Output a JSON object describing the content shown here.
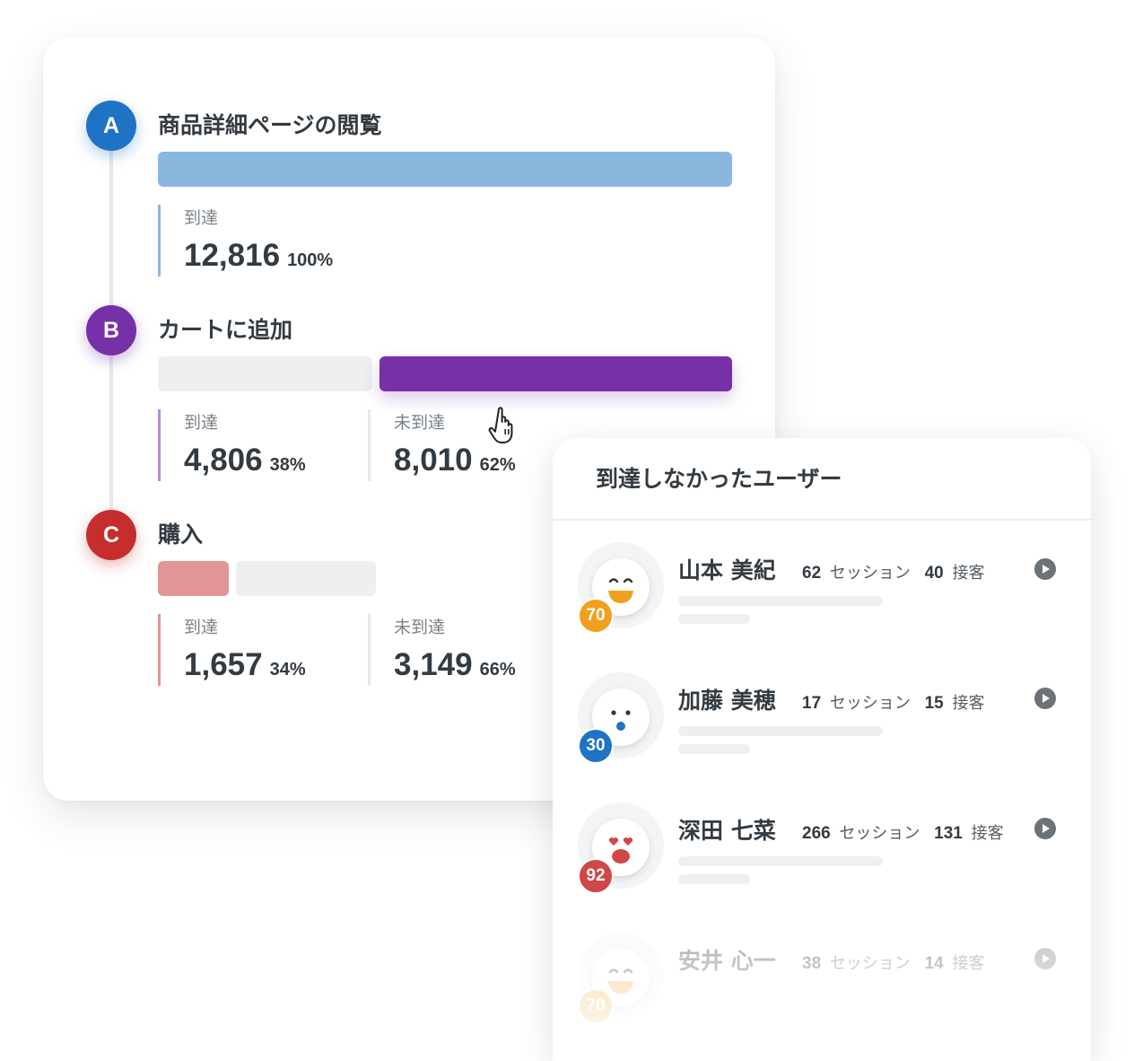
{
  "funnel": {
    "steps": [
      {
        "letter": "A",
        "title": "商品詳細ページの閲覧",
        "color": "#1f73c4",
        "bar_color": "#8ab7de",
        "reached": {
          "label": "到達",
          "count": "12,816",
          "percent": "100%",
          "fraction": 1.0
        }
      },
      {
        "letter": "B",
        "title": "カートに追加",
        "color": "#7630a8",
        "bar_color": "#7630a8",
        "reached": {
          "label": "到達",
          "count": "4,806",
          "percent": "38%",
          "fraction": 0.38
        },
        "not_reached": {
          "label": "未到達",
          "count": "8,010",
          "percent": "62%",
          "fraction": 0.62
        }
      },
      {
        "letter": "C",
        "title": "購入",
        "color": "#c62d2d",
        "bar_color": "#e09696",
        "reached": {
          "label": "到達",
          "count": "1,657",
          "percent": "34%",
          "fraction": 0.34
        },
        "not_reached": {
          "label": "未到達",
          "count": "3,149",
          "percent": "66%",
          "fraction": 0.66
        }
      }
    ]
  },
  "users_panel": {
    "title": "到達しなかったユーザー",
    "session_label": "セッション",
    "engagement_label": "接客",
    "users": [
      {
        "name": "山本 美紀",
        "sessions": "62",
        "engagements": "40",
        "score": "70",
        "score_color": "#f0a01e",
        "face": "happy-face-icon"
      },
      {
        "name": "加藤 美穂",
        "sessions": "17",
        "engagements": "15",
        "score": "30",
        "score_color": "#1f73c4",
        "face": "surprised-face-icon"
      },
      {
        "name": "深田 七菜",
        "sessions": "266",
        "engagements": "131",
        "score": "92",
        "score_color": "#d14646",
        "face": "heart-eyes-face-icon"
      },
      {
        "name": "安井 心一",
        "sessions": "38",
        "engagements": "14",
        "score": "70",
        "score_color": "#f0a01e",
        "face": "happy-face-icon"
      }
    ]
  }
}
